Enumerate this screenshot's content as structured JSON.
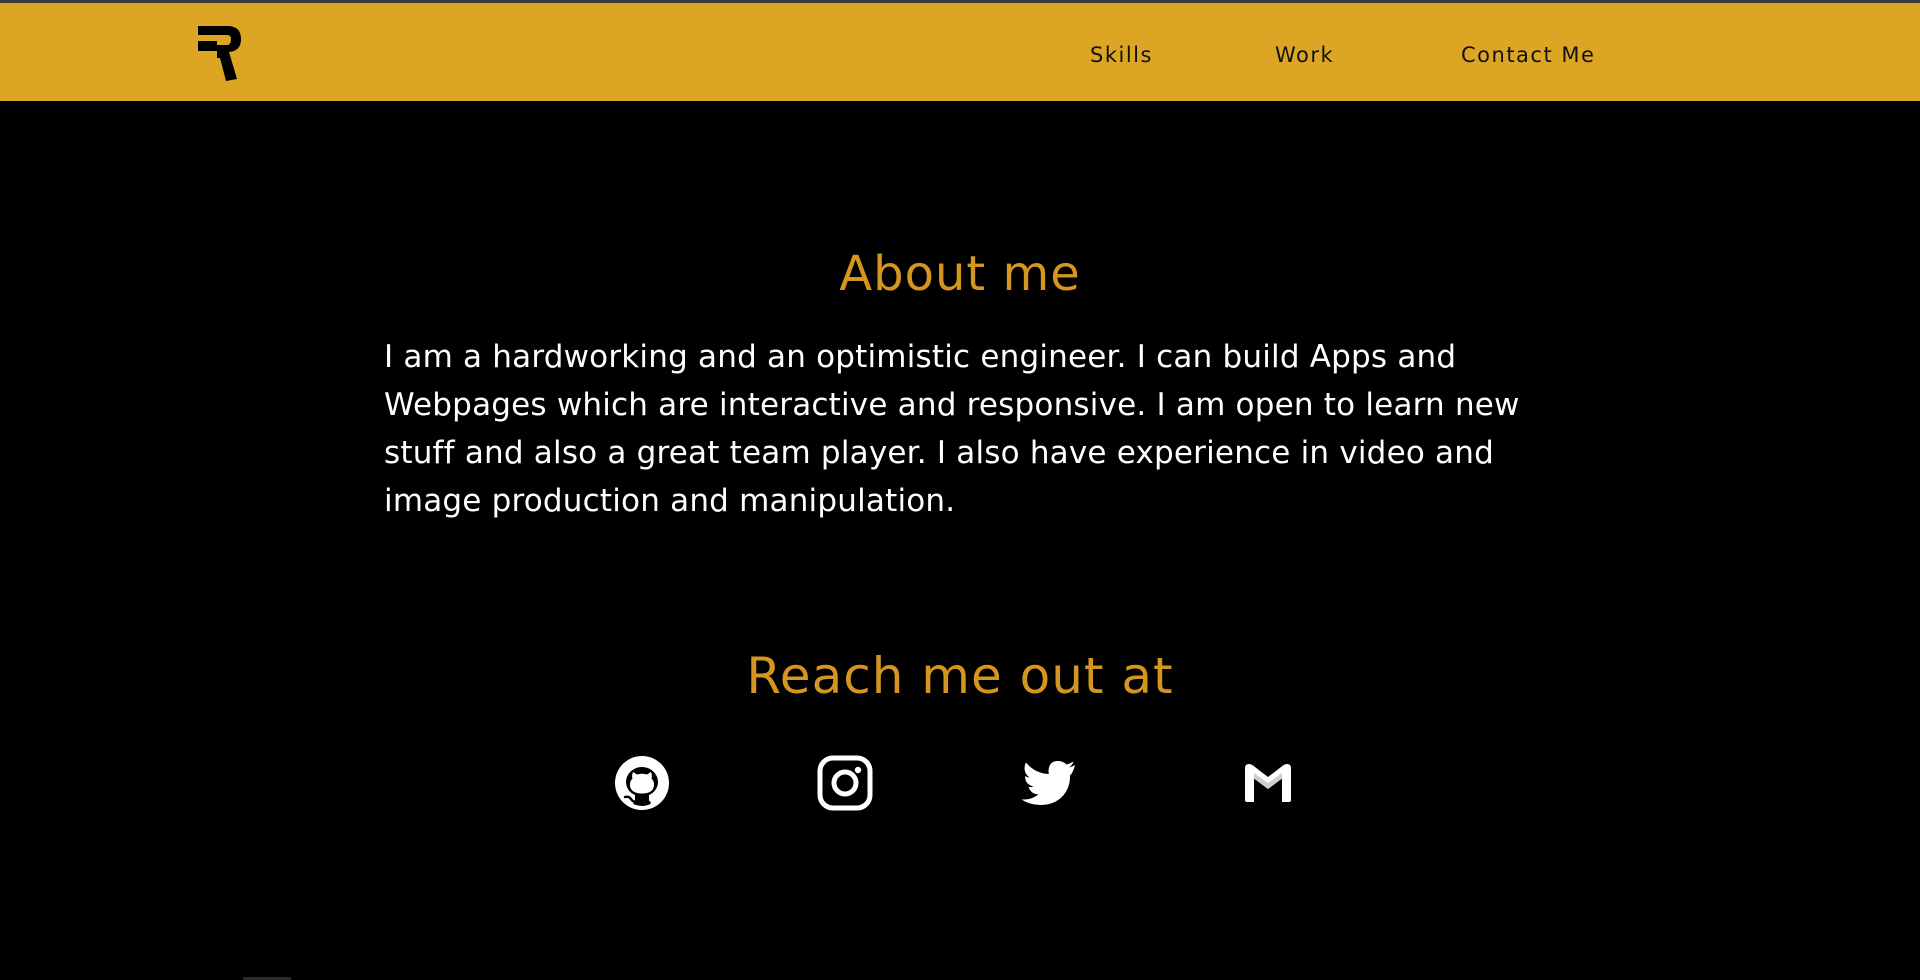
{
  "header": {
    "logo_icon": "r-logo-icon",
    "nav": [
      {
        "label": "Skills"
      },
      {
        "label": "Work"
      },
      {
        "label": "Contact Me"
      }
    ]
  },
  "about": {
    "title": "About me",
    "text": "I am a hardworking and an optimistic engineer. I can build Apps and Webpages which are interactive and responsive. I am open to learn new stuff and also a great team player. I also have experience in video and image production and manipulation."
  },
  "contact": {
    "title": "Reach me out at",
    "links": [
      {
        "icon": "github-icon"
      },
      {
        "icon": "instagram-icon"
      },
      {
        "icon": "twitter-icon"
      },
      {
        "icon": "gmail-icon"
      }
    ]
  },
  "colors": {
    "navbar": "#dca624",
    "background": "#000000",
    "heading": "#d4961e",
    "text": "#ffffff"
  }
}
